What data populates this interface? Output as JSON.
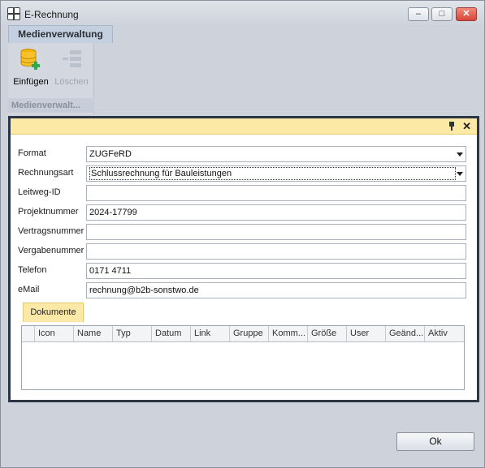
{
  "window": {
    "title": "E-Rechnung",
    "minimize": "–",
    "maximize": "□",
    "close": "✕"
  },
  "ribbon": {
    "tab": "Medienverwaltung",
    "buttons": [
      {
        "label": "Einfügen",
        "icon": "database-add-icon",
        "enabled": true
      },
      {
        "label": "Löschen",
        "icon": "delete-row-icon",
        "enabled": false
      }
    ],
    "group_label": "Medienverwalt..."
  },
  "panel": {
    "pin": "pin-icon",
    "close": "✕"
  },
  "form": {
    "format": {
      "label": "Format",
      "value": "ZUGFeRD"
    },
    "rechnungsart": {
      "label": "Rechnungsart",
      "value": "Schlussrechnung für Bauleistungen"
    },
    "leitweg": {
      "label": "Leitweg-ID",
      "value": ""
    },
    "projekt": {
      "label": "Projektnummer",
      "value": "2024-17799"
    },
    "vertrag": {
      "label": "Vertragsnummer",
      "value": ""
    },
    "vergabe": {
      "label": "Vergabenummer",
      "value": ""
    },
    "telefon": {
      "label": "Telefon",
      "value": "0171 4711"
    },
    "email": {
      "label": "eMail",
      "value": "rechnung@b2b-sonstwo.de"
    }
  },
  "documents": {
    "tab": "Dokumente",
    "columns": [
      "Icon",
      "Name",
      "Typ",
      "Datum",
      "Link",
      "Gruppe",
      "Komm...",
      "Größe",
      "User",
      "Geänd...",
      "Aktiv"
    ]
  },
  "footer": {
    "ok": "Ok"
  },
  "colors": {
    "accent_yellow": "#fde9a6",
    "panel_border": "#2a3546",
    "window_bg": "#cdd2db"
  }
}
